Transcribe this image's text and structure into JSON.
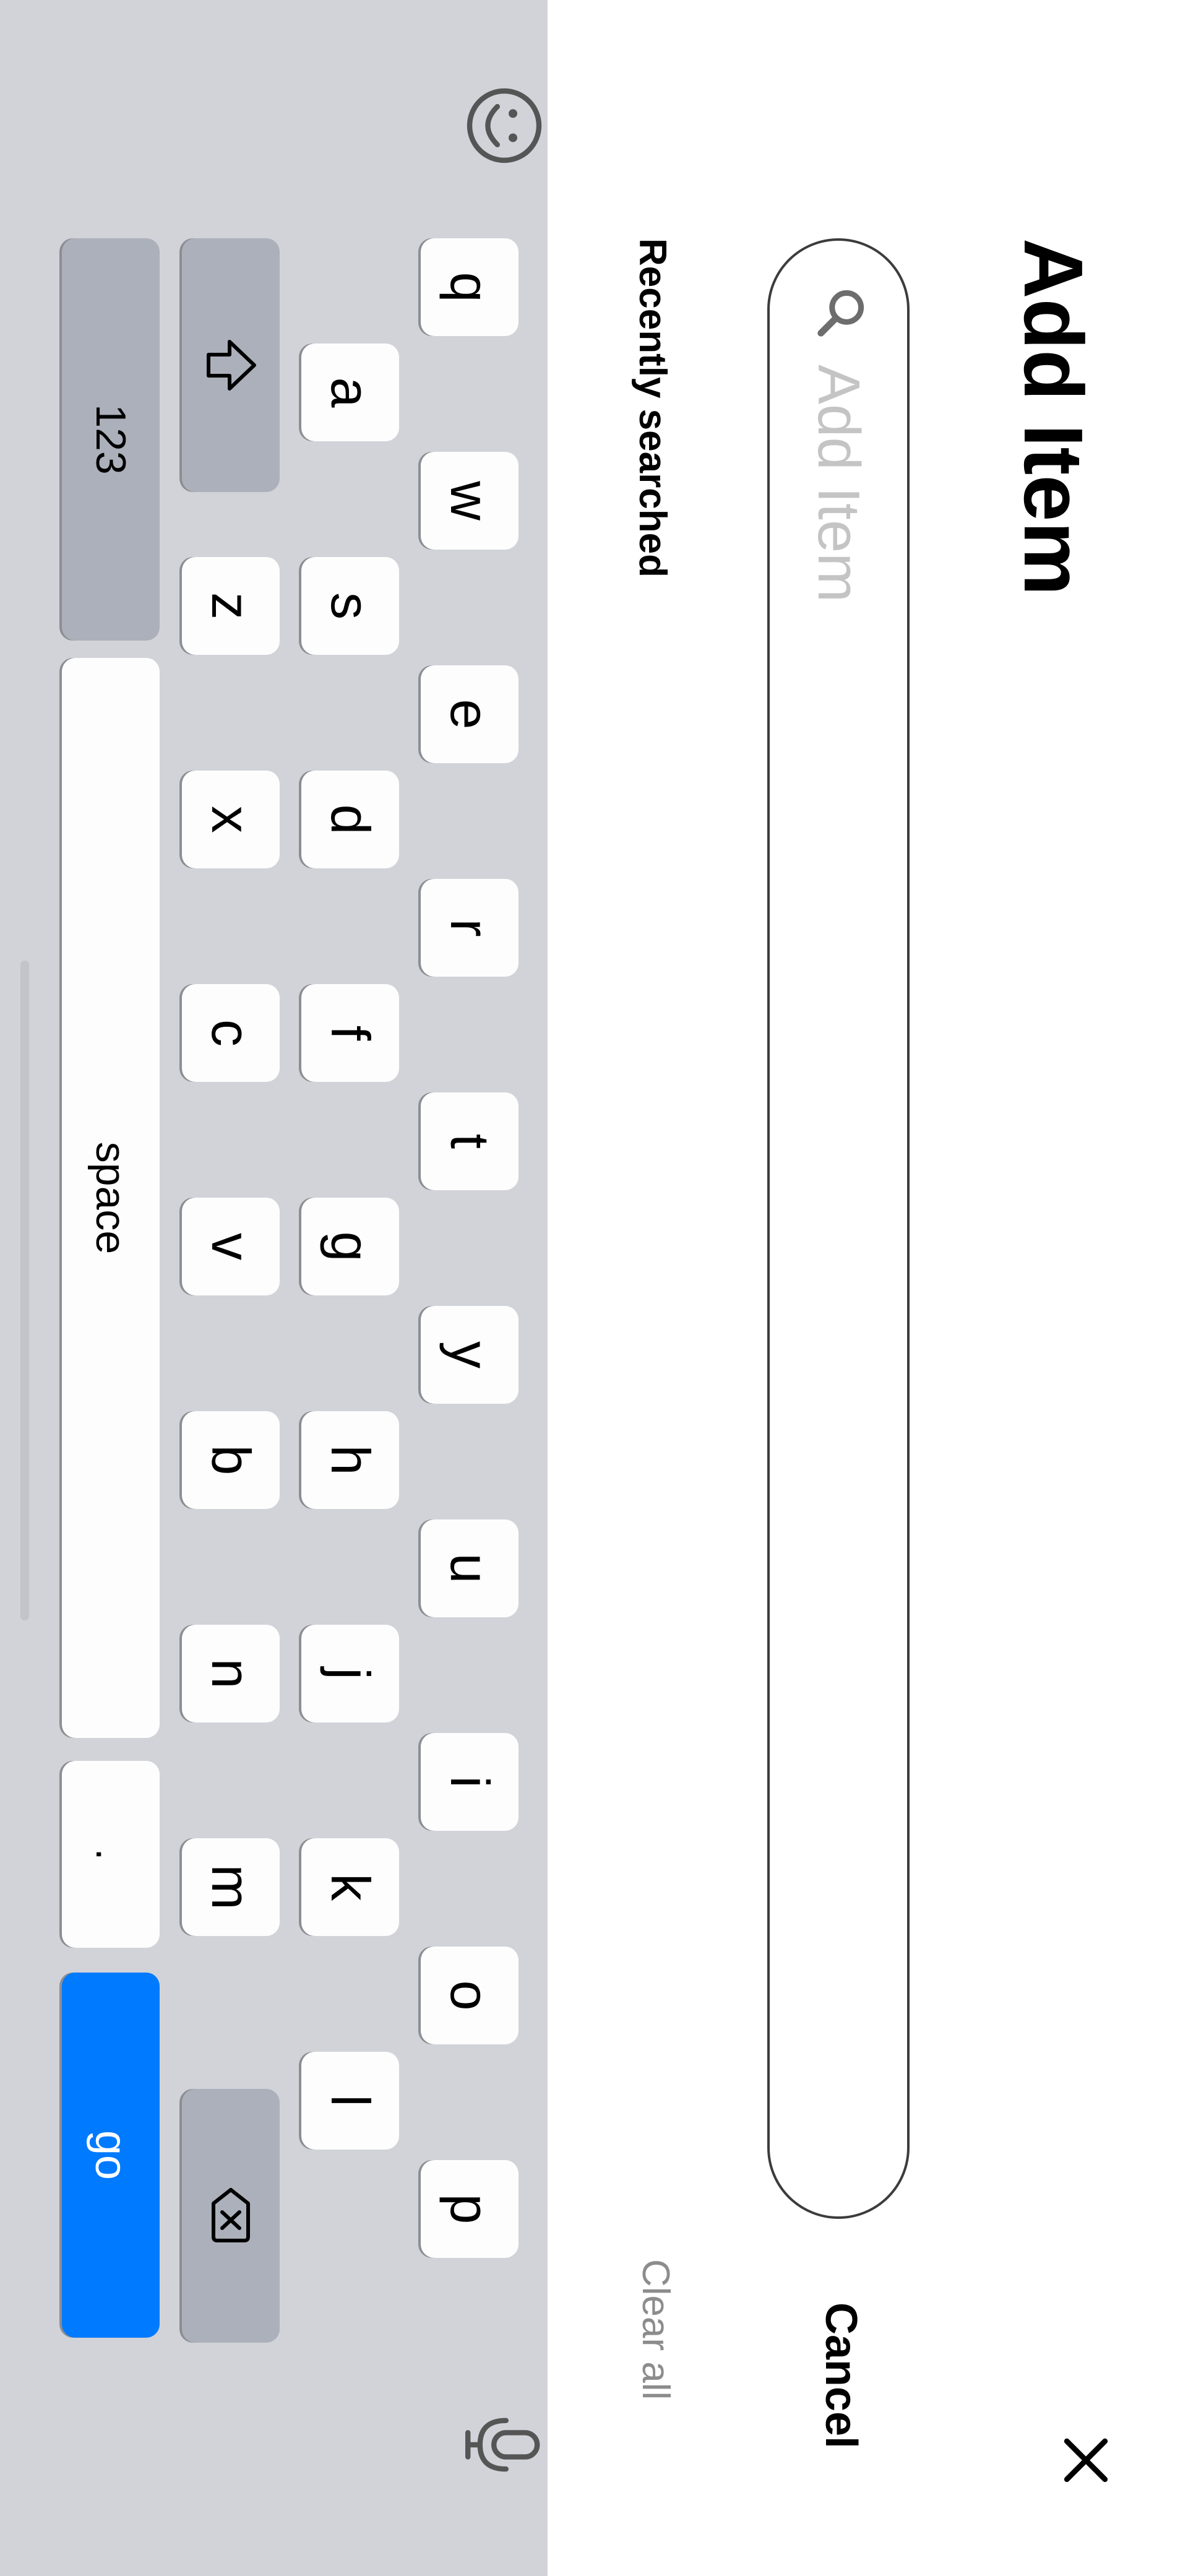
{
  "header": {
    "title": "Add Item"
  },
  "search": {
    "placeholder": "Add Item",
    "value": "",
    "cancel_label": "Cancel"
  },
  "recent": {
    "heading": "Recently searched",
    "clear_label": "Clear all"
  },
  "keyboard": {
    "row1": [
      "q",
      "w",
      "e",
      "r",
      "t",
      "y",
      "u",
      "i",
      "o",
      "p"
    ],
    "row2": [
      "a",
      "s",
      "d",
      "f",
      "g",
      "h",
      "j",
      "k",
      "l"
    ],
    "row3": [
      "z",
      "x",
      "c",
      "v",
      "b",
      "n",
      "m"
    ],
    "numbers_label": "123",
    "space_label": "space",
    "period_label": ".",
    "go_label": "go",
    "accent_color": "#007aff"
  },
  "icons": {
    "close": "close-icon",
    "search": "search-icon",
    "shift": "shift-icon",
    "backspace": "backspace-icon",
    "emoji": "emoji-icon",
    "mic": "microphone-icon"
  }
}
